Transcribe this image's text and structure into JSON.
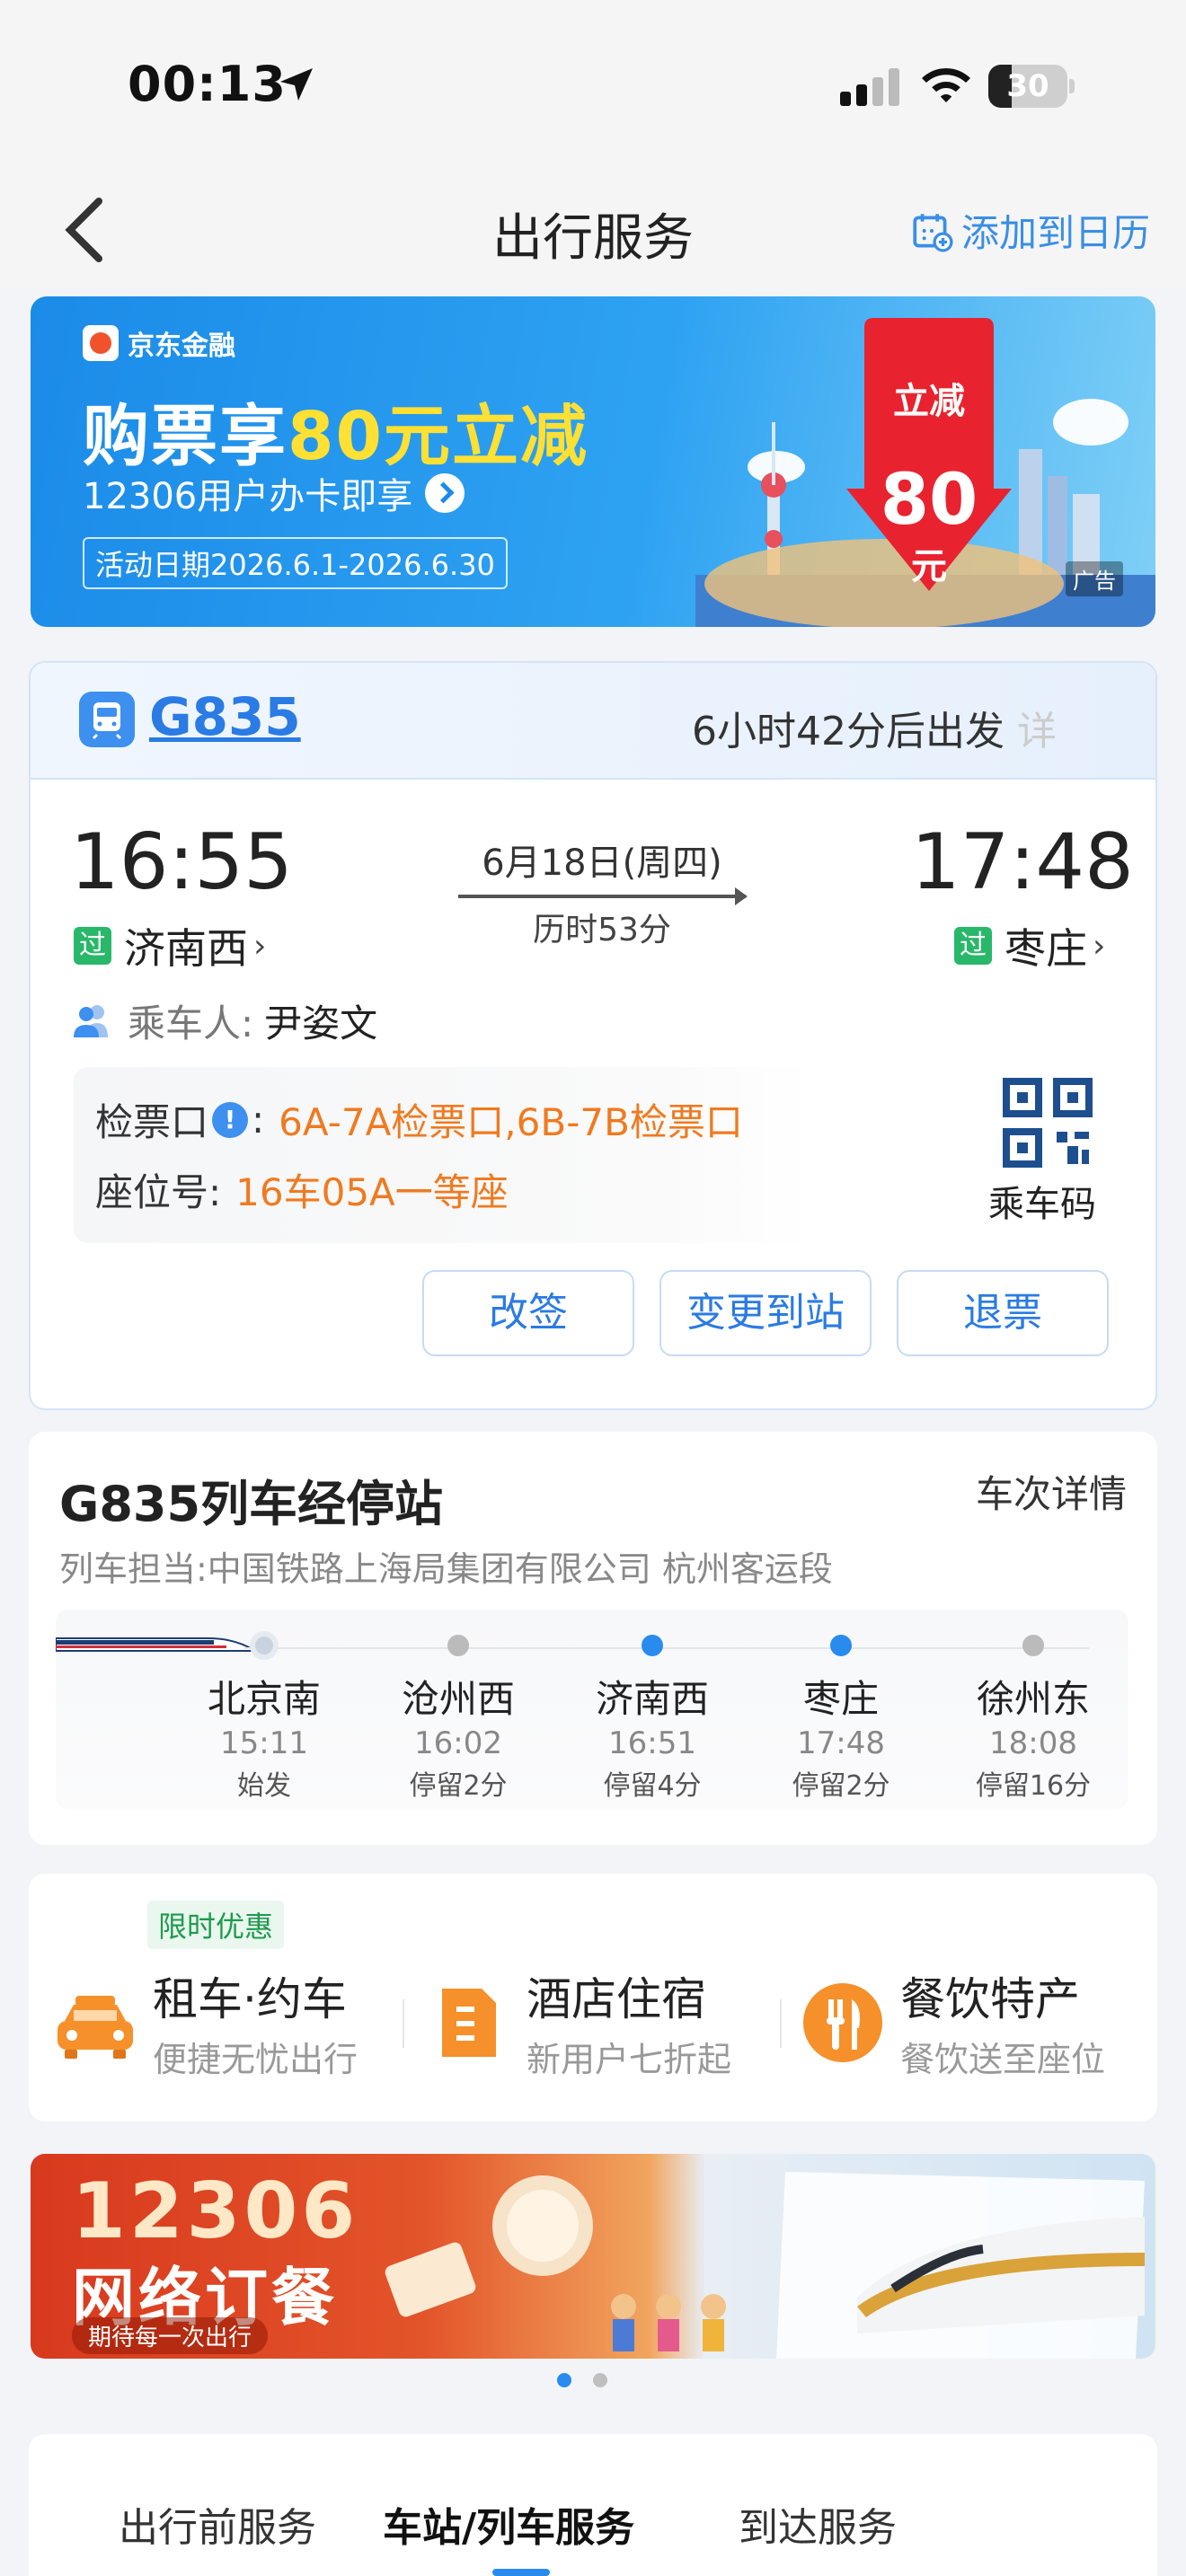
{
  "status_bar": {
    "time": "00:13",
    "battery": "30",
    "battery_fraction": 0.3
  },
  "nav": {
    "title": "出行服务",
    "calendar_label": "添加到日历"
  },
  "promo_banner": {
    "brand": "京东金融",
    "headline_prefix": "购票享",
    "headline_highlight": "80元立减",
    "sub": "12306用户办卡即享",
    "date": "活动日期2026.6.1-2026.6.30",
    "badge_top": "立减",
    "badge_amount": "80",
    "badge_unit": "元",
    "ad_label": "广告"
  },
  "ticket": {
    "train_no": "G835",
    "countdown": "6小时42分后出发",
    "countdown_more": "详",
    "departure_time": "16:55",
    "arrival_time": "17:48",
    "date": "6月18日(周四)",
    "duration": "历时53分",
    "pass_badge": "过",
    "departure_station": "济南西",
    "arrival_station": "枣庄",
    "chevron": "›",
    "passenger_label": "乘车人:",
    "passenger_name": "尹姿文",
    "gate_label": "检票口",
    "gate_alert": "!",
    "colon": ":",
    "gate_value": "6A-7A检票口,6B-7B检票口",
    "seat_label": "座位号:",
    "seat_value": "16车05A一等座",
    "qr_label": "乘车码",
    "buttons": {
      "change": "改签",
      "change_destination": "变更到站",
      "refund": "退票"
    }
  },
  "stops": {
    "title": "G835列车经停站",
    "detail_link": "车次详情",
    "operator": "列车担当:中国铁路上海局集团有限公司 杭州客运段",
    "items": [
      {
        "name": "北京南",
        "time": "15:11",
        "stay": "始发"
      },
      {
        "name": "沧州西",
        "time": "16:02",
        "stay": "停留2分"
      },
      {
        "name": "济南西",
        "time": "16:51",
        "stay": "停留4分"
      },
      {
        "name": "枣庄",
        "time": "17:48",
        "stay": "停留2分"
      },
      {
        "name": "徐州东",
        "time": "18:08",
        "stay": "停留16分"
      }
    ]
  },
  "services": {
    "limited_tag": "限时优惠",
    "items": [
      {
        "name": "租车·约车",
        "desc": "便捷无忧出行",
        "icon": "car-icon",
        "color": "#f5902b"
      },
      {
        "name": "酒店住宿",
        "desc": "新用户七折起",
        "icon": "hotel-icon",
        "color": "#f5902b"
      },
      {
        "name": "餐饮特产",
        "desc": "餐饮送至座位",
        "icon": "food-icon",
        "color": "#f5902b"
      }
    ]
  },
  "food_banner": {
    "line1": "12306",
    "line2": "网络订餐",
    "tagline": "期待每一次出行"
  },
  "tabs": [
    {
      "label": "出行前服务"
    },
    {
      "label": "车站/列车服务",
      "active": true
    },
    {
      "label": "到达服务"
    }
  ],
  "colors": {
    "accent": "#2a7be4",
    "orange": "#f07a20",
    "green": "#29b86a"
  }
}
